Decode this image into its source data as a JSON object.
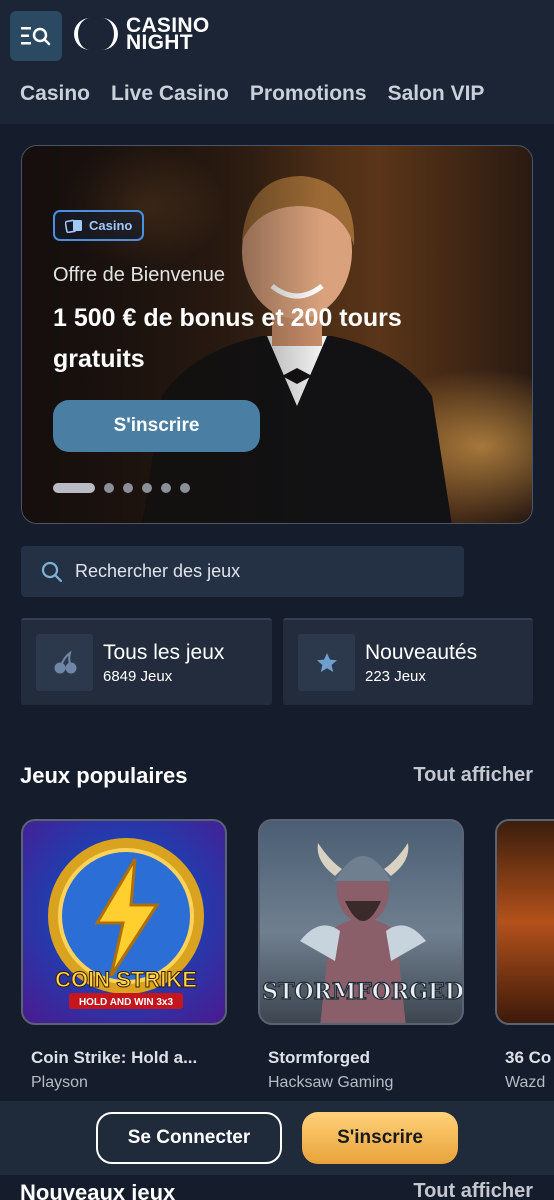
{
  "header": {
    "logo_line1": "CASINO",
    "logo_line2": "NIGHT",
    "nav": [
      "Casino",
      "Live Casino",
      "Promotions",
      "Salon VIP"
    ]
  },
  "hero": {
    "badge": "Casino",
    "kicker": "Offre de Bienvenue",
    "title": "1 500 € de bonus et 200 tours gratuits",
    "cta": "S'inscrire",
    "slides_total": 6,
    "active_slide": 1
  },
  "search": {
    "placeholder": "Rechercher des jeux"
  },
  "categories": [
    {
      "title": "Tous les jeux",
      "count": "6849 Jeux",
      "icon": "cherries-icon"
    },
    {
      "title": "Nouveautés",
      "count": "223 Jeux",
      "icon": "star-icon"
    }
  ],
  "popular": {
    "heading": "Jeux populaires",
    "link": "Tout afficher",
    "games": [
      {
        "title": "Coin Strike: Hold a...",
        "provider": "Playson",
        "art_line1": "COIN STRIKE",
        "art_line2": "HOLD AND WIN 3x3"
      },
      {
        "title": "Stormforged",
        "provider": "Hacksaw Gaming",
        "art_line1": "STORMFORGED"
      },
      {
        "title": "36 Co",
        "provider": "Wazd"
      }
    ]
  },
  "bottom": {
    "login": "Se Connecter",
    "signup": "S'inscrire"
  },
  "new_games": {
    "heading": "Nouveaux jeux",
    "link": "Tout afficher"
  }
}
